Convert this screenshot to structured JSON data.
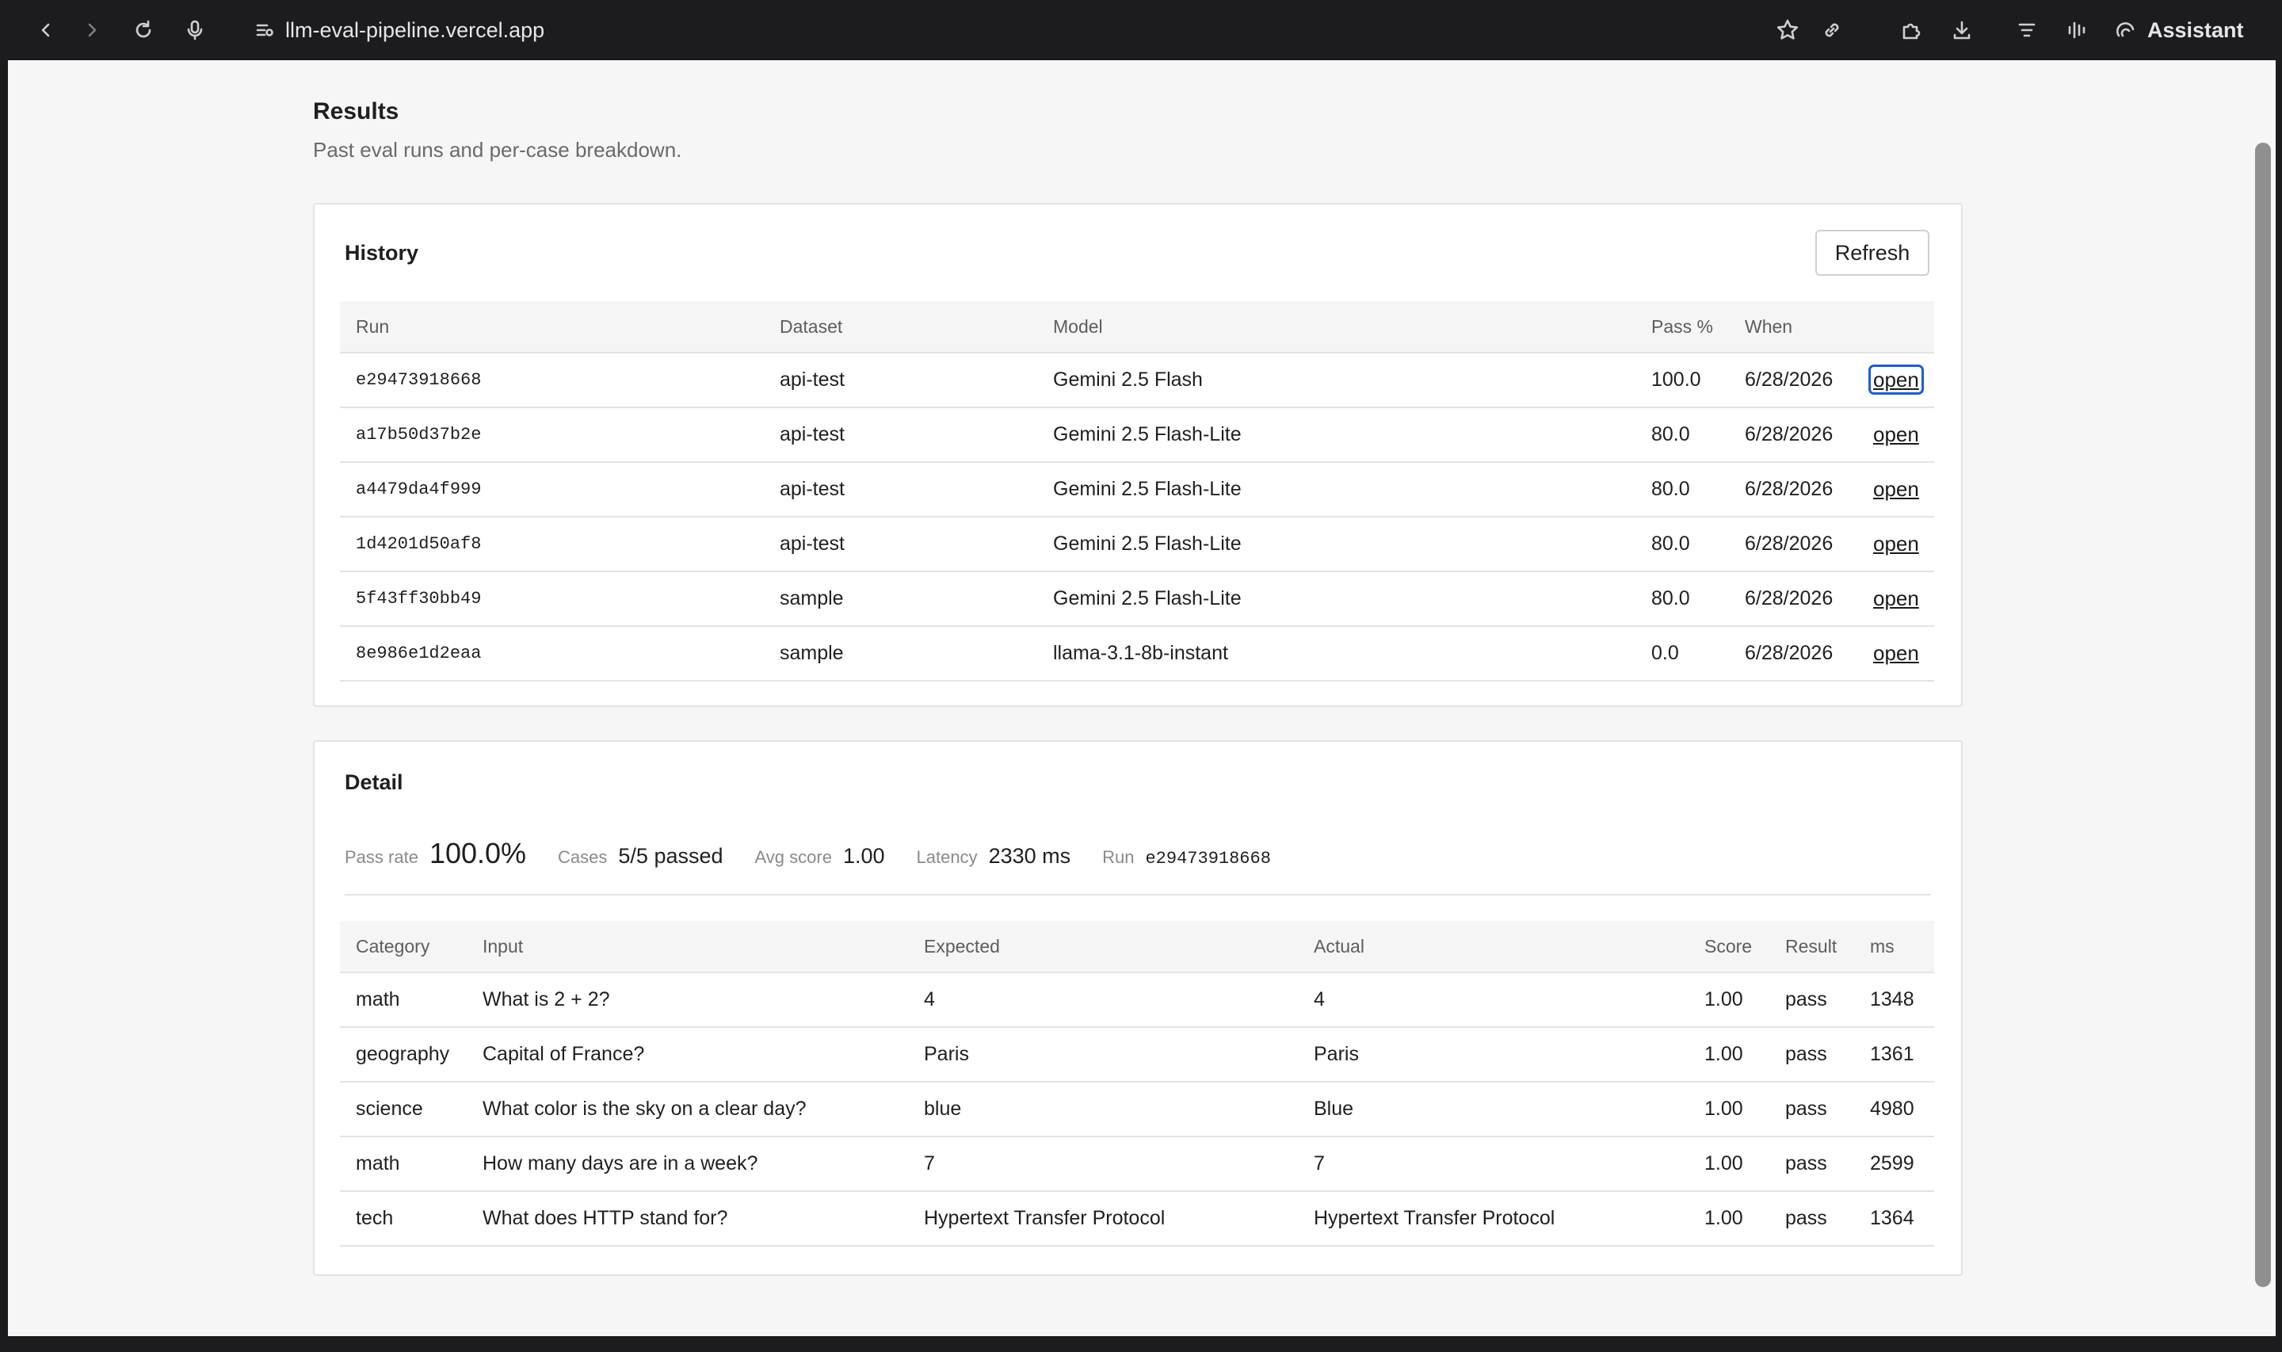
{
  "browser": {
    "url": "llm-eval-pipeline.vercel.app",
    "assistant_label": "Assistant"
  },
  "page": {
    "title": "Results",
    "subtitle": "Past eval runs and per-case breakdown."
  },
  "history": {
    "title": "History",
    "refresh_label": "Refresh",
    "columns": [
      "Run",
      "Dataset",
      "Model",
      "Pass %",
      "When",
      ""
    ],
    "rows": [
      {
        "run": "e29473918668",
        "dataset": "api-test",
        "model": "Gemini 2.5 Flash",
        "pass": "100.0",
        "when": "6/28/2026",
        "action": "open"
      },
      {
        "run": "a17b50d37b2e",
        "dataset": "api-test",
        "model": "Gemini 2.5 Flash-Lite",
        "pass": "80.0",
        "when": "6/28/2026",
        "action": "open"
      },
      {
        "run": "a4479da4f999",
        "dataset": "api-test",
        "model": "Gemini 2.5 Flash-Lite",
        "pass": "80.0",
        "when": "6/28/2026",
        "action": "open"
      },
      {
        "run": "1d4201d50af8",
        "dataset": "api-test",
        "model": "Gemini 2.5 Flash-Lite",
        "pass": "80.0",
        "when": "6/28/2026",
        "action": "open"
      },
      {
        "run": "5f43ff30bb49",
        "dataset": "sample",
        "model": "Gemini 2.5 Flash-Lite",
        "pass": "80.0",
        "when": "6/28/2026",
        "action": "open"
      },
      {
        "run": "8e986e1d2eaa",
        "dataset": "sample",
        "model": "llama-3.1-8b-instant",
        "pass": "0.0",
        "when": "6/28/2026",
        "action": "open"
      }
    ]
  },
  "detail": {
    "title": "Detail",
    "metrics": {
      "pass_rate_label": "Pass rate",
      "pass_rate": "100.0%",
      "cases_label": "Cases",
      "cases": "5/5 passed",
      "avg_score_label": "Avg score",
      "avg_score": "1.00",
      "latency_label": "Latency",
      "latency": "2330 ms",
      "run_label": "Run",
      "run": "e29473918668"
    },
    "columns": [
      "Category",
      "Input",
      "Expected",
      "Actual",
      "Score",
      "Result",
      "ms"
    ],
    "rows": [
      {
        "category": "math",
        "input": "What is 2 + 2?",
        "expected": "4",
        "actual": "4",
        "score": "1.00",
        "result": "pass",
        "ms": "1348"
      },
      {
        "category": "geography",
        "input": "Capital of France?",
        "expected": "Paris",
        "actual": "Paris",
        "score": "1.00",
        "result": "pass",
        "ms": "1361"
      },
      {
        "category": "science",
        "input": "What color is the sky on a clear day?",
        "expected": "blue",
        "actual": "Blue",
        "score": "1.00",
        "result": "pass",
        "ms": "4980"
      },
      {
        "category": "math",
        "input": "How many days are in a week?",
        "expected": "7",
        "actual": "7",
        "score": "1.00",
        "result": "pass",
        "ms": "2599"
      },
      {
        "category": "tech",
        "input": "What does HTTP stand for?",
        "expected": "Hypertext Transfer Protocol",
        "actual": "Hypertext Transfer Protocol",
        "score": "1.00",
        "result": "pass",
        "ms": "1364"
      }
    ]
  },
  "colors": {
    "chrome_bg": "#1c1c1e",
    "page_bg": "#f6f6f6",
    "focus_ring": "#1f5bd8"
  }
}
